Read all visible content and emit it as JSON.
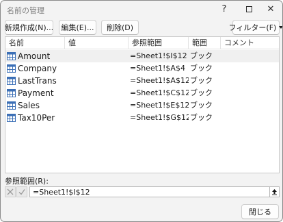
{
  "window": {
    "title": "名前の管理",
    "help_glyph": "?",
    "close_glyph": "✕"
  },
  "toolbar": {
    "new_label": "新規作成(N)...",
    "edit_label": "編集(E)...",
    "delete_label": "削除(D)",
    "filter_label": "フィルター(F)"
  },
  "list": {
    "columns": {
      "name": "名前",
      "value": "値",
      "ref": "参照範囲",
      "scope": "範囲",
      "comment": "コメント"
    },
    "rows": [
      {
        "name": "Amount",
        "value": "",
        "ref": "=Sheet1!$I$12",
        "scope": "ブック",
        "comment": "",
        "selected": true
      },
      {
        "name": "Company",
        "value": "",
        "ref": "=Sheet1!$A$4",
        "scope": "ブック",
        "comment": "",
        "selected": false
      },
      {
        "name": "LastTrans",
        "value": "",
        "ref": "=Sheet1!$A$12",
        "scope": "ブック",
        "comment": "",
        "selected": false
      },
      {
        "name": "Payment",
        "value": "",
        "ref": "=Sheet1!$C$12",
        "scope": "ブック",
        "comment": "",
        "selected": false
      },
      {
        "name": "Sales",
        "value": "",
        "ref": "=Sheet1!$E$12",
        "scope": "ブック",
        "comment": "",
        "selected": false
      },
      {
        "name": "Tax10Per",
        "value": "",
        "ref": "=Sheet1!$G$12",
        "scope": "ブック",
        "comment": "",
        "selected": false
      }
    ]
  },
  "refers_to": {
    "label": "参照範囲(R):",
    "value": "=Sheet1!$I$12"
  },
  "footer": {
    "close_label": "閉じる"
  },
  "colors": {
    "window_bg": "#f3f3f3",
    "list_bg": "#ffffff",
    "selected_row": "#f0f0f0",
    "table_icon": "#3b6fb6"
  }
}
